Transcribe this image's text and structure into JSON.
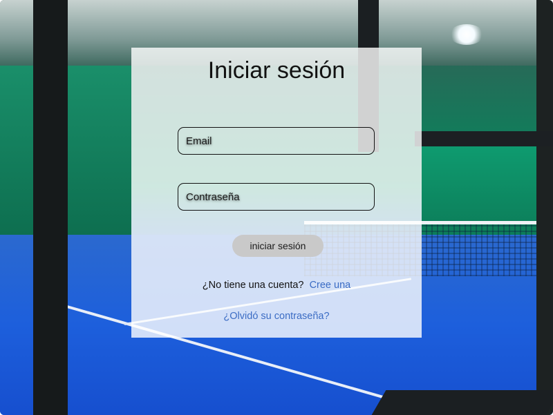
{
  "login": {
    "title": "Iniciar sesión",
    "email_placeholder": "Email",
    "password_placeholder": "Contraseña",
    "submit_label": "iniciar sesión",
    "no_account_text": "¿No tiene una cuenta?",
    "signup_link": "Cree una",
    "forgot_link": "¿Olvidó su contraseña?"
  },
  "colors": {
    "link": "#3b6cc4",
    "button_bg": "#c9c9c9",
    "panel_bg": "rgba(255,255,255,0.80)"
  }
}
